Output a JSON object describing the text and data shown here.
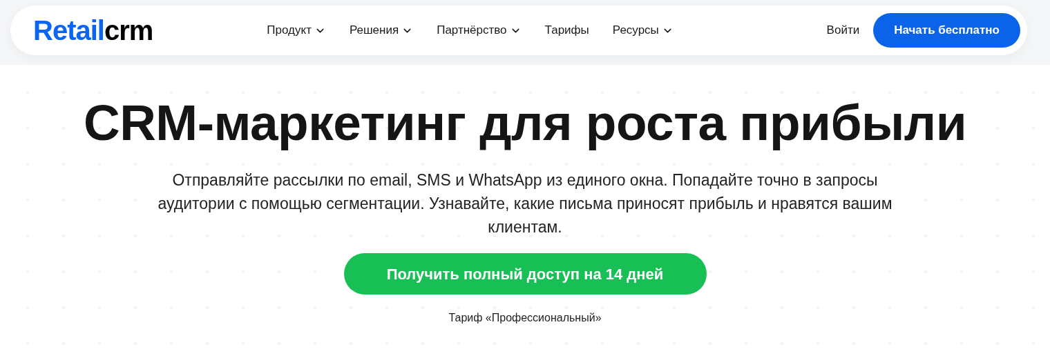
{
  "header": {
    "logo": {
      "accent": "Retail",
      "rest": "crm"
    },
    "nav": [
      {
        "label": "Продукт",
        "has_menu": true
      },
      {
        "label": "Решения",
        "has_menu": true
      },
      {
        "label": "Партнёрство",
        "has_menu": true
      },
      {
        "label": "Тарифы",
        "has_menu": false
      },
      {
        "label": "Ресурсы",
        "has_menu": true
      }
    ],
    "login": "Войти",
    "cta": "Начать бесплатно"
  },
  "hero": {
    "title": "CRM-маркетинг для роста прибыли",
    "description": "Отправляйте рассылки по email, SMS и WhatsApp из единого окна. Попадайте точно в запросы аудитории с помощью сегментации. Узнавайте, какие письма приносят прибыль и нравятся вашим клиентам.",
    "cta": "Получить полный доступ на 14 дней",
    "note": "Тариф «Профессиональный»"
  }
}
